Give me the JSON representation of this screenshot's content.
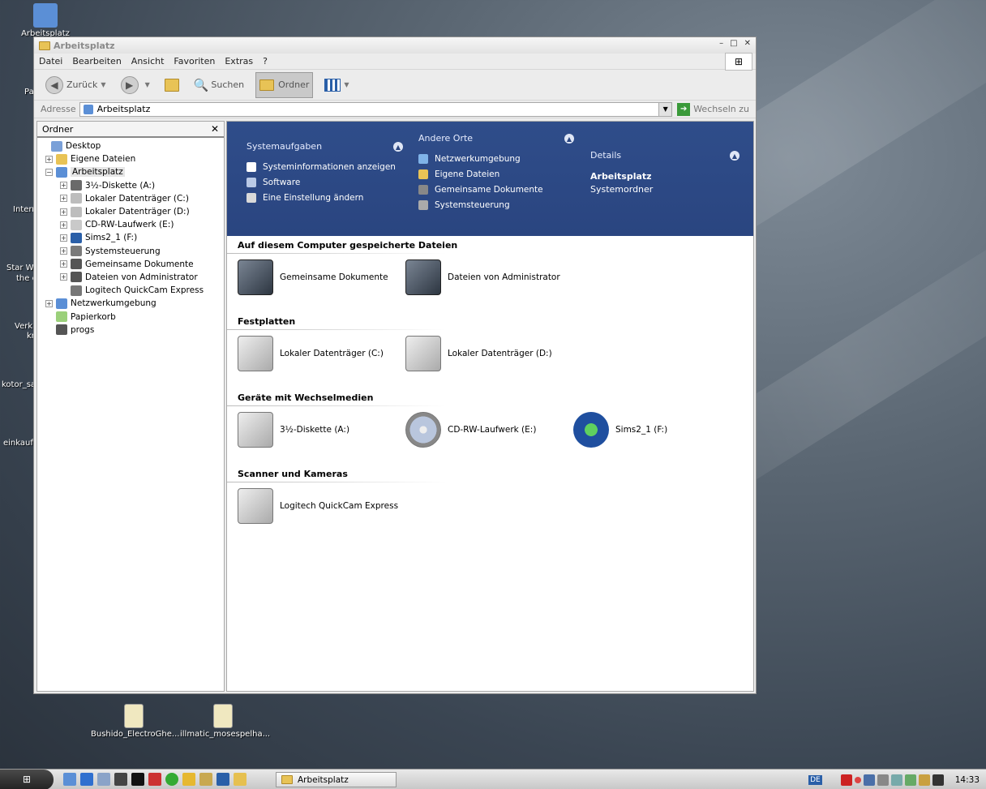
{
  "desktop": {
    "icons": [
      {
        "label": "Arbeitsplatz",
        "color": "#5b8fd6"
      },
      {
        "label": "Bushido_ElectroGhe...",
        "color": "#f0e8c0"
      },
      {
        "label": "illmatic_mosespelha...",
        "color": "#f0e8c0"
      }
    ],
    "clipped_labels": [
      "Pa",
      "Intern",
      "Star Wa",
      "the c",
      "Verkn",
      "kn",
      "kotor_sa",
      "einkaufs"
    ]
  },
  "window": {
    "title": "Arbeitsplatz",
    "controls": {
      "minimize": "–",
      "maximize": "□",
      "close": "✕"
    },
    "menu": [
      "Datei",
      "Bearbeiten",
      "Ansicht",
      "Favoriten",
      "Extras",
      "?"
    ],
    "toolbar": {
      "back": "Zurück",
      "search": "Suchen",
      "folders": "Ordner"
    },
    "address": {
      "label": "Adresse",
      "value": "Arbeitsplatz",
      "go": "Wechseln zu"
    }
  },
  "tree": {
    "header": "Ordner",
    "close": "✕",
    "items": [
      {
        "label": "Desktop",
        "expander": "",
        "color": "#7aa0d8"
      },
      {
        "label": "Eigene Dateien",
        "expander": "+",
        "color": "#e8c356"
      },
      {
        "label": "Arbeitsplatz",
        "expander": "−",
        "color": "#5b8fd6"
      },
      {
        "label": "3½-Diskette (A:)",
        "expander": "+",
        "color": "#6a6a6a"
      },
      {
        "label": "Lokaler Datenträger (C:)",
        "expander": "+",
        "color": "#bdbdbd"
      },
      {
        "label": "Lokaler Datenträger (D:)",
        "expander": "+",
        "color": "#bdbdbd"
      },
      {
        "label": "CD-RW-Laufwerk (E:)",
        "expander": "+",
        "color": "#c9c9c9"
      },
      {
        "label": "Sims2_1 (F:)",
        "expander": "+",
        "color": "#2a5fa8"
      },
      {
        "label": "Systemsteuerung",
        "expander": "+",
        "color": "#7a7a7a"
      },
      {
        "label": "Gemeinsame Dokumente",
        "expander": "+",
        "color": "#555"
      },
      {
        "label": "Dateien von Administrator",
        "expander": "+",
        "color": "#555"
      },
      {
        "label": "Logitech QuickCam Express",
        "expander": "",
        "color": "#777"
      },
      {
        "label": "Netzwerkumgebung",
        "expander": "+",
        "color": "#5b8fd6"
      },
      {
        "label": "Papierkorb",
        "expander": "",
        "color": "#9bd07a"
      },
      {
        "label": "progs",
        "expander": "",
        "color": "#555"
      }
    ]
  },
  "tasks": {
    "system": {
      "title": "Systemaufgaben",
      "links": [
        "Systeminformationen anzeigen",
        "Software",
        "Eine Einstellung ändern"
      ]
    },
    "other": {
      "title": "Andere Orte",
      "links": [
        "Netzwerkumgebung",
        "Eigene Dateien",
        "Gemeinsame Dokumente",
        "Systemsteuerung"
      ]
    },
    "details": {
      "title": "Details",
      "name": "Arbeitsplatz",
      "type": "Systemordner"
    }
  },
  "sections": [
    {
      "title": "Auf diesem Computer gespeicherte Dateien",
      "items": [
        {
          "label": "Gemeinsame Dokumente",
          "kind": "folder"
        },
        {
          "label": "Dateien von Administrator",
          "kind": "folder"
        }
      ]
    },
    {
      "title": "Festplatten",
      "items": [
        {
          "label": "Lokaler Datenträger (C:)",
          "kind": "drive"
        },
        {
          "label": "Lokaler Datenträger (D:)",
          "kind": "drive"
        }
      ]
    },
    {
      "title": "Geräte mit Wechselmedien",
      "items": [
        {
          "label": "3½-Diskette (A:)",
          "kind": "floppy"
        },
        {
          "label": "CD-RW-Laufwerk (E:)",
          "kind": "cd"
        },
        {
          "label": "Sims2_1 (F:)",
          "kind": "sims"
        }
      ]
    },
    {
      "title": "Scanner und Kameras",
      "items": [
        {
          "label": "Logitech QuickCam Express",
          "kind": "camera"
        }
      ]
    }
  ],
  "taskbar": {
    "active_window": "Arbeitsplatz",
    "language": "DE",
    "clock": "14:33"
  }
}
